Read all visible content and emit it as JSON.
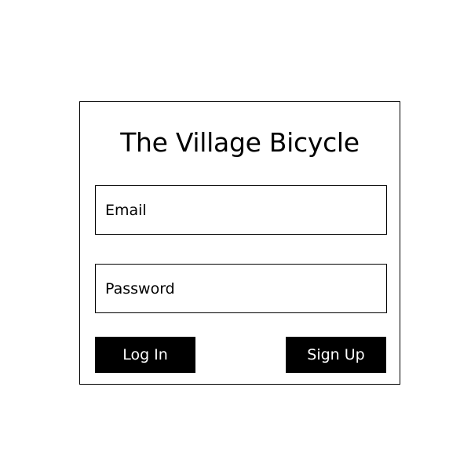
{
  "app": {
    "title": "The Village Bicycle"
  },
  "form": {
    "email_placeholder": "Email",
    "email_value": "",
    "password_placeholder": "Password",
    "password_value": "",
    "login_label": "Log In",
    "signup_label": "Sign Up"
  },
  "colors": {
    "background": "#ffffff",
    "border": "#000000",
    "button_bg": "#000000",
    "button_text": "#ffffff"
  }
}
